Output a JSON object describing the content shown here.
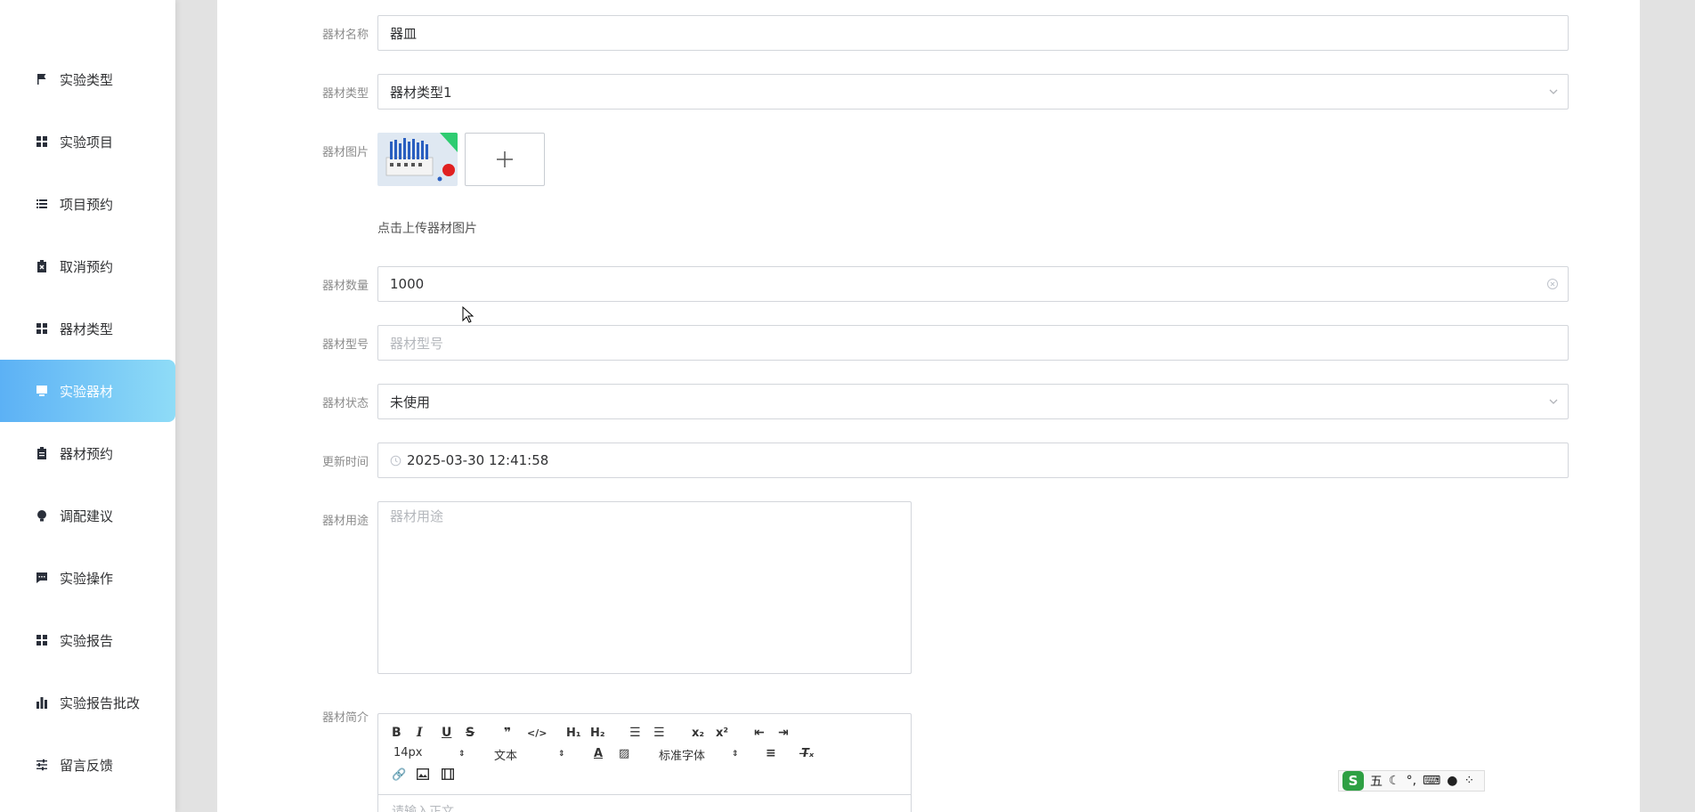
{
  "sidebar": {
    "items": [
      {
        "label": "实验类型",
        "icon": "flag-icon",
        "active": false
      },
      {
        "label": "实验项目",
        "icon": "grid-icon",
        "active": false
      },
      {
        "label": "项目预约",
        "icon": "list-icon",
        "active": false
      },
      {
        "label": "取消预约",
        "icon": "clipboard-x-icon",
        "active": false
      },
      {
        "label": "器材类型",
        "icon": "grid-icon",
        "active": false
      },
      {
        "label": "实验器材",
        "icon": "monitor-icon",
        "active": true
      },
      {
        "label": "器材预约",
        "icon": "clipboard-icon",
        "active": false
      },
      {
        "label": "调配建议",
        "icon": "bulb-icon",
        "active": false
      },
      {
        "label": "实验操作",
        "icon": "chat-icon",
        "active": false
      },
      {
        "label": "实验报告",
        "icon": "grid-icon",
        "active": false
      },
      {
        "label": "实验报告批改",
        "icon": "bar-chart-icon",
        "active": false
      },
      {
        "label": "留言反馈",
        "icon": "sliders-icon",
        "active": false
      }
    ]
  },
  "form": {
    "name": {
      "label": "器材名称",
      "value": "器皿"
    },
    "type": {
      "label": "器材类型",
      "value": "器材类型1"
    },
    "image": {
      "label": "器材图片",
      "hint": "点击上传器材图片"
    },
    "quantity": {
      "label": "器材数量",
      "value": "1000"
    },
    "model": {
      "label": "器材型号",
      "placeholder": "器材型号"
    },
    "status": {
      "label": "器材状态",
      "value": "未使用"
    },
    "updated": {
      "label": "更新时间",
      "value": "2025-03-30 12:41:58"
    },
    "usage": {
      "label": "器材用途",
      "placeholder": "器材用途"
    },
    "intro": {
      "label": "器材简介",
      "font_size": "14px",
      "block_type": "文本",
      "font_family": "标准字体",
      "body_placeholder": "请输入正文..."
    }
  },
  "ime": {
    "mode": "五"
  },
  "colors": {
    "active_start": "#5cb1f5",
    "active_end": "#8fdcf7",
    "background": "#e2e2e2"
  }
}
